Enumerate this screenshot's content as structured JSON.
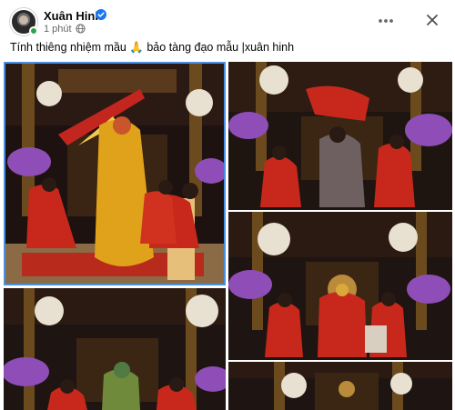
{
  "post": {
    "author_name": "Xuân Hinh",
    "time": "1 phút",
    "caption": "Tính thiêng nhiệm mầu 🙏 bảo tàng đạo mẫu |xuân hinh"
  },
  "icons": {
    "verified": "verified-badge-icon",
    "audience": "globe-icon",
    "more": "more-options-icon",
    "close": "close-icon"
  },
  "colors": {
    "verified": "#1877f2",
    "online": "#31a24c",
    "selection": "#4a90e2",
    "robe_red": "#c8281c",
    "robe_gold": "#e0a21a"
  },
  "photos": [
    {
      "name": "photo-1-ceremony-golden-robe"
    },
    {
      "name": "photo-2-red-veil-dance"
    },
    {
      "name": "photo-3-altar-red-figure"
    },
    {
      "name": "photo-4-purple-orchids"
    },
    {
      "name": "photo-5-altar-partial"
    }
  ]
}
